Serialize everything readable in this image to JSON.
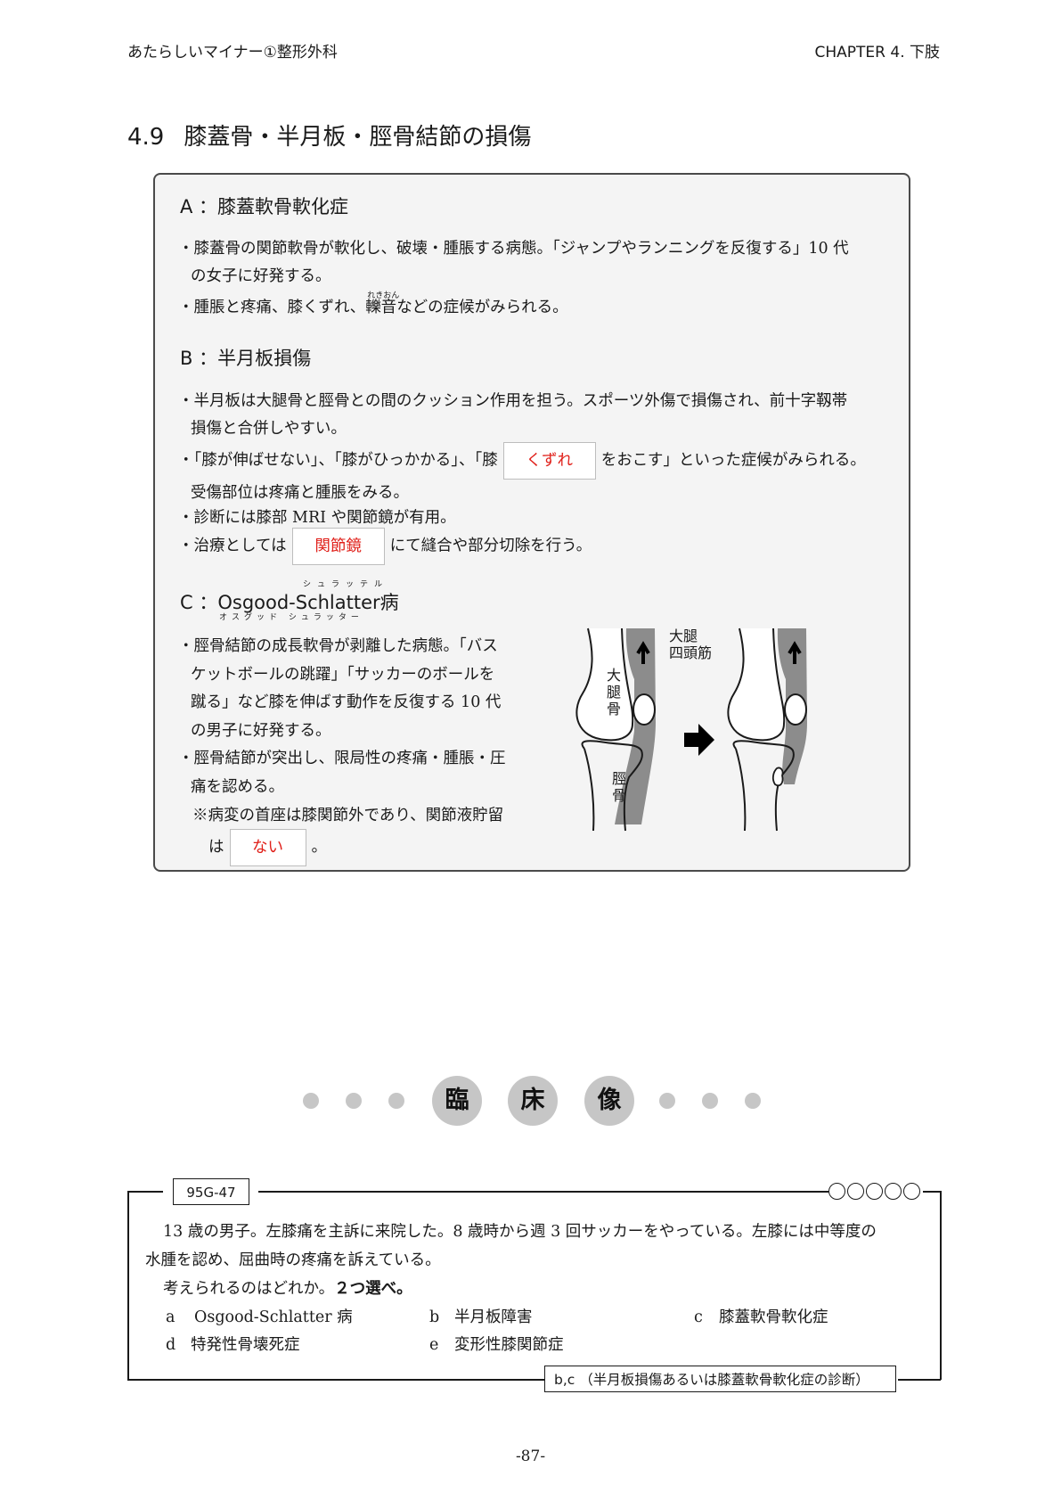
{
  "header": {
    "left": "あたらしいマイナー①整形外科",
    "right": "CHAPTER 4.  下肢"
  },
  "section": {
    "number": "4.9",
    "title": "膝蓋骨・半月板・脛骨結節の損傷"
  },
  "a": {
    "heading": "A ：膝蓋軟骨軟化症",
    "b1_l1": "・膝蓋骨の関節軟骨が軟化し、破壊・腫脹する病態。「ジャンプやランニングを反復する」10 代",
    "b1_l2": "の女子に好発する。",
    "b2_pre": "・腫脹と疼痛、膝くずれ、",
    "b2_word": "轢音",
    "b2_ruby": "れきおん",
    "b2_post": "などの症候がみられる。"
  },
  "b": {
    "heading": "B ：半月板損傷",
    "b1_l1": "・半月板は大腿骨と脛骨との間のクッション作用を担う。スポーツ外傷で損傷され、前十字靱帯",
    "b1_l2": "損傷と合併しやすい。",
    "b2_pre": "・「膝が伸ばせない」、「膝がひっかかる」、「膝",
    "b2_blank": "くずれ",
    "b2_post": "をおこす」といった症候がみられる。",
    "b2_l2": "受傷部位は疼痛と腫脹をみる。",
    "b3": "・診断には膝部 MRI や関節鏡が有用。",
    "b4_pre": "・治療としては",
    "b4_blank": "関節鏡",
    "b4_post": "にて縫合や部分切除を行う。"
  },
  "c": {
    "heading_prefix": "C ：",
    "heading_name": "Osgood-Schlatter",
    "heading_suffix": "病",
    "ruby_top": "シュラッテル",
    "ruby_bottom": "オスグッド シュラッター",
    "b1_l1": "・脛骨結節の成長軟骨が剥離した病態。「バス",
    "b1_l2": "ケットボールの跳躍」「サッカーのボールを",
    "b1_l3": "蹴る」など膝を伸ばす動作を反復する 10 代",
    "b1_l4": "の男子に好発する。",
    "b2_l1": "・脛骨結節が突出し、限局性の疼痛・腫脹・圧",
    "b2_l2": "痛を認める。",
    "note": "※病変の首座は膝関節外であり、関節液貯留",
    "note2_pre": "は",
    "note2_blank": "ない",
    "note2_post": "。",
    "fig_quad_l1": "大腿",
    "fig_quad_l2": "四頭筋",
    "fig_femur": "大\n腿\n骨",
    "fig_tibia": "脛\n骨"
  },
  "clinical": {
    "chars": [
      "臨",
      "床",
      "像"
    ]
  },
  "question": {
    "id": "95G-47",
    "l1": "13 歳の男子。左膝痛を主訴に来院した。8 歳時から週 3 回サッカーをやっている。左膝には中等度の",
    "l2": "水腫を認め、屈曲時の疼痛を訴えている。",
    "prompt": "考えられるのはどれか。",
    "prompt_bold": "２つ選べ。",
    "choices": [
      {
        "letter": "a",
        "text": "Osgood-Schlatter 病"
      },
      {
        "letter": "b",
        "text": "半月板障害"
      },
      {
        "letter": "c",
        "text": "膝蓋軟骨軟化症"
      },
      {
        "letter": "d",
        "text": "特発性骨壊死症"
      },
      {
        "letter": "e",
        "text": "変形性膝関節症"
      }
    ],
    "answer": "b,c （半月板損傷あるいは膝蓋軟骨軟化症の診断）"
  },
  "page_number": "-87-"
}
